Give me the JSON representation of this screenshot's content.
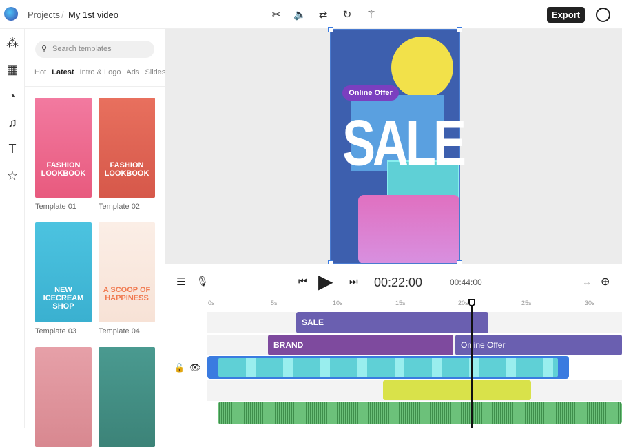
{
  "header": {
    "breadcrumb_root": "Projects",
    "breadcrumb_sep": "/",
    "project_name": "My 1st video",
    "export_label": "Export",
    "tools": [
      {
        "icon": "scissors-icon",
        "glyph": "✂"
      },
      {
        "icon": "volume-icon",
        "glyph": "🔈"
      },
      {
        "icon": "swap-icon",
        "glyph": "⇄"
      },
      {
        "icon": "rotate-icon",
        "glyph": "↻"
      },
      {
        "icon": "magic-wand-icon",
        "glyph": "⚚"
      }
    ]
  },
  "rail": [
    {
      "icon": "elements-icon",
      "glyph": "⁂"
    },
    {
      "icon": "media-icon",
      "glyph": "▦"
    },
    {
      "icon": "sticker-icon",
      "glyph": "◔"
    },
    {
      "icon": "music-icon",
      "glyph": "♫"
    },
    {
      "icon": "text-icon",
      "glyph": "T"
    },
    {
      "icon": "star-icon",
      "glyph": "☆"
    }
  ],
  "panel": {
    "search_placeholder": "Search templates",
    "tabs": [
      "Hot",
      "Latest",
      "Intro & Logo",
      "Ads",
      "Slides"
    ],
    "active_tab": "Latest",
    "templates": [
      {
        "label": "Template 01",
        "title": "FASHION LOOKBOOK",
        "bg": "linear-gradient(#f27aa0,#e85a7e)"
      },
      {
        "label": "Template 02",
        "title": "FASHION LOOKBOOK",
        "bg": "linear-gradient(#e8705e,#d6584a)"
      },
      {
        "label": "Template 03",
        "title": "NEW ICECREAM SHOP",
        "bg": "linear-gradient(#4cc3e0,#3ab0d0)"
      },
      {
        "label": "Template 04",
        "title": "A SCOOP OF HAPPINESS",
        "bg": "linear-gradient(#fbeee6,#f7e2d6)"
      },
      {
        "label": "",
        "title": "",
        "bg": "linear-gradient(#e6a0a8,#d88890)"
      },
      {
        "label": "",
        "title": "",
        "bg": "linear-gradient(#4a9a90,#3c8378)"
      }
    ]
  },
  "preview": {
    "badge": "Online Offer",
    "headline": "SALE"
  },
  "player": {
    "current_time": "00:22:00",
    "total_time": "00:44:00"
  },
  "ruler": [
    "0s",
    "5s",
    "10s",
    "15s",
    "20s",
    "25s",
    "30s"
  ],
  "tracks": {
    "sale_clip": "SALE",
    "brand_clip": "BRAND",
    "offer_clip": "Online Offer"
  },
  "colors": {
    "accent": "#3a7be0",
    "sale_clip": "#6a5fb0",
    "brand_clip": "#7e4a9e",
    "sticker_track": "#d9e24a",
    "audio_track": "#6cc17a"
  }
}
